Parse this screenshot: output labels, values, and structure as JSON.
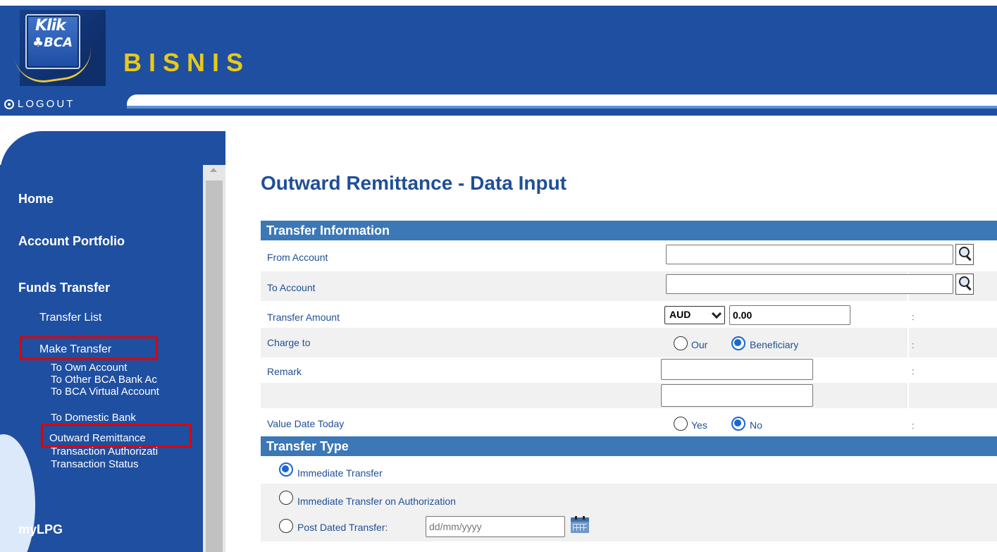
{
  "header": {
    "logo_klik": "Klik",
    "logo_bca": "♣BCA",
    "brand": "BISNIS",
    "logout_label": "LOGOUT",
    "logout_icon": "power-circle-icon"
  },
  "sidebar": {
    "items": {
      "home": "Home",
      "account_portfolio": "Account Portfolio",
      "funds_transfer": "Funds Transfer",
      "transfer_list": "Transfer List",
      "make_transfer": "Make Transfer",
      "to_own_account": "To Own Account",
      "to_other_bca": "To Other BCA Bank Ac",
      "to_bca_virtual": "To BCA Virtual Account",
      "to_domestic_bank": "To Domestic Bank",
      "outward_remittance": "Outward Remittance",
      "transaction_authorization": "Transaction Authorizati",
      "transaction_status": "Transaction Status",
      "mylpg": "myLPG"
    },
    "highlighted": [
      "Make Transfer",
      "Outward Remittance"
    ],
    "highlight_color": "#e00000"
  },
  "main": {
    "title": "Outward Remittance - Data Input",
    "transfer_information": {
      "heading": "Transfer Information",
      "from_account_label": "From Account",
      "from_account_value": "",
      "to_account_label": "To Account",
      "to_account_value": "",
      "transfer_amount_label": "Transfer Amount",
      "currency": "AUD",
      "amount": "0.00",
      "charge_to_label": "Charge to",
      "charge_options": [
        "Our",
        "Beneficiary"
      ],
      "charge_selected": "Beneficiary",
      "remark_label": "Remark",
      "remark_1": "",
      "remark_2": "",
      "value_date_today_label": "Value Date Today",
      "value_date_options": [
        "Yes",
        "No"
      ],
      "value_date_selected": "No",
      "colon": ":"
    },
    "transfer_type": {
      "heading": "Transfer Type",
      "options": [
        "Immediate Transfer",
        "Immediate Transfer on Authorization",
        "Post Dated Transfer:"
      ],
      "selected": "Immediate Transfer",
      "date_placeholder": "dd/mm/yyyy"
    }
  },
  "colors": {
    "brand_blue": "#1f4fa0",
    "section_header": "#3c78b6",
    "label_text": "#1f4f96",
    "brand_yellow": "#e8c91a",
    "radio_selected": "#1967d2"
  }
}
